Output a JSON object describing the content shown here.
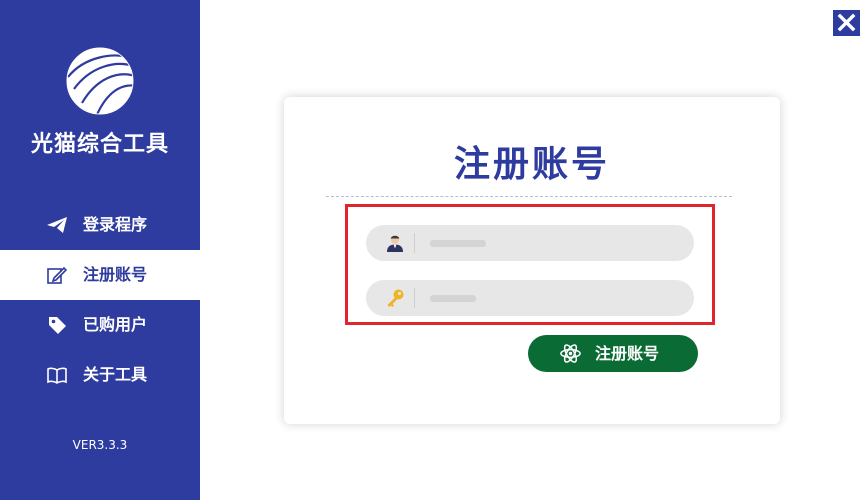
{
  "app": {
    "title": "光猫综合工具",
    "version": "VER3.3.3",
    "brand_color": "#2e3b9f"
  },
  "sidebar": {
    "items": [
      {
        "label": "登录程序",
        "icon": "paper-plane-icon",
        "active": false
      },
      {
        "label": "注册账号",
        "icon": "edit-icon",
        "active": true
      },
      {
        "label": "已购用户",
        "icon": "tag-icon",
        "active": false
      },
      {
        "label": "关于工具",
        "icon": "book-icon",
        "active": false
      }
    ]
  },
  "window": {
    "close_icon": "close-icon"
  },
  "register_card": {
    "title": "注册账号",
    "username": {
      "icon": "user-icon",
      "value": ""
    },
    "password": {
      "icon": "key-icon",
      "value": ""
    },
    "highlight_color": "#e1252b",
    "submit": {
      "label": "注册账号",
      "icon": "atom-icon",
      "color": "#0b6b34"
    }
  }
}
